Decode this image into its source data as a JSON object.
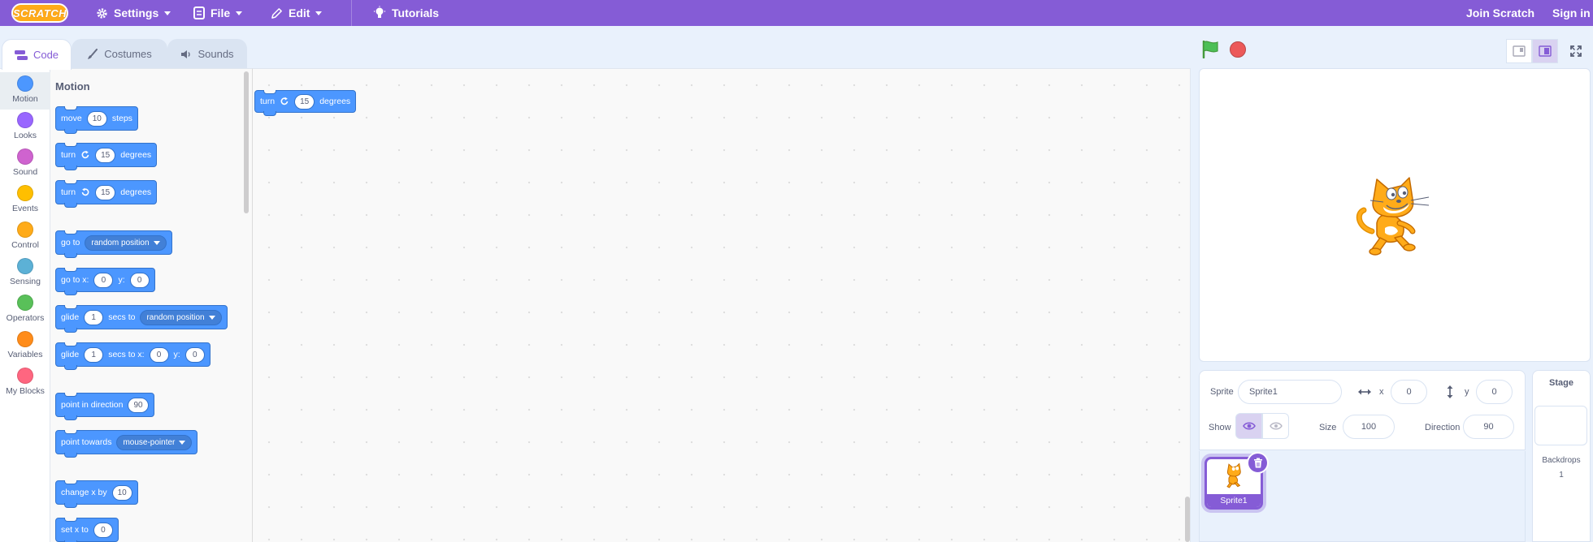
{
  "menubar": {
    "logo_text": "SCRATCH",
    "settings": "Settings",
    "file": "File",
    "edit": "Edit",
    "tutorials": "Tutorials",
    "join": "Join Scratch",
    "signin": "Sign in"
  },
  "tabs": {
    "code": "Code",
    "costumes": "Costumes",
    "sounds": "Sounds"
  },
  "categories": [
    {
      "label": "Motion",
      "color": "#4c97ff"
    },
    {
      "label": "Looks",
      "color": "#9966ff"
    },
    {
      "label": "Sound",
      "color": "#cf63cf"
    },
    {
      "label": "Events",
      "color": "#ffbf00"
    },
    {
      "label": "Control",
      "color": "#ffab19"
    },
    {
      "label": "Sensing",
      "color": "#5cb1d6"
    },
    {
      "label": "Operators",
      "color": "#59c059"
    },
    {
      "label": "Variables",
      "color": "#ff8c1a"
    },
    {
      "label": "My Blocks",
      "color": "#ff6680"
    }
  ],
  "palette": {
    "title": "Motion",
    "move": {
      "a": "move",
      "v": "10",
      "b": "steps"
    },
    "turn_right": {
      "a": "turn",
      "v": "15",
      "b": "degrees"
    },
    "turn_left": {
      "a": "turn",
      "v": "15",
      "b": "degrees"
    },
    "goto": {
      "a": "go to",
      "dd": "random position"
    },
    "goto_xy": {
      "a": "go to x:",
      "x": "0",
      "b": "y:",
      "y": "0"
    },
    "glide_to": {
      "a": "glide",
      "v": "1",
      "b": "secs to",
      "dd": "random position"
    },
    "glide_xy": {
      "a": "glide",
      "v": "1",
      "b": "secs to x:",
      "x": "0",
      "c": "y:",
      "y": "0"
    },
    "point_dir": {
      "a": "point in direction",
      "v": "90"
    },
    "point_towards": {
      "a": "point towards",
      "dd": "mouse-pointer"
    },
    "change_x": {
      "a": "change x by",
      "v": "10"
    },
    "set_x": {
      "a": "set x to",
      "v": "0"
    }
  },
  "workspace": {
    "block": {
      "a": "turn",
      "v": "15",
      "b": "degrees"
    }
  },
  "sprite_info": {
    "sprite_label": "Sprite",
    "sprite_name": "Sprite1",
    "x_label": "x",
    "x_value": "0",
    "y_label": "y",
    "y_value": "0",
    "show_label": "Show",
    "size_label": "Size",
    "size_value": "100",
    "direction_label": "Direction",
    "direction_value": "90"
  },
  "sprites": [
    {
      "name": "Sprite1"
    }
  ],
  "stage_pane": {
    "title": "Stage",
    "backdrops_label": "Backdrops",
    "backdrops_count": "1"
  },
  "colors": {
    "menu": "#855cd6",
    "motion": "#4c97ff",
    "background": "#e9f1fc"
  }
}
